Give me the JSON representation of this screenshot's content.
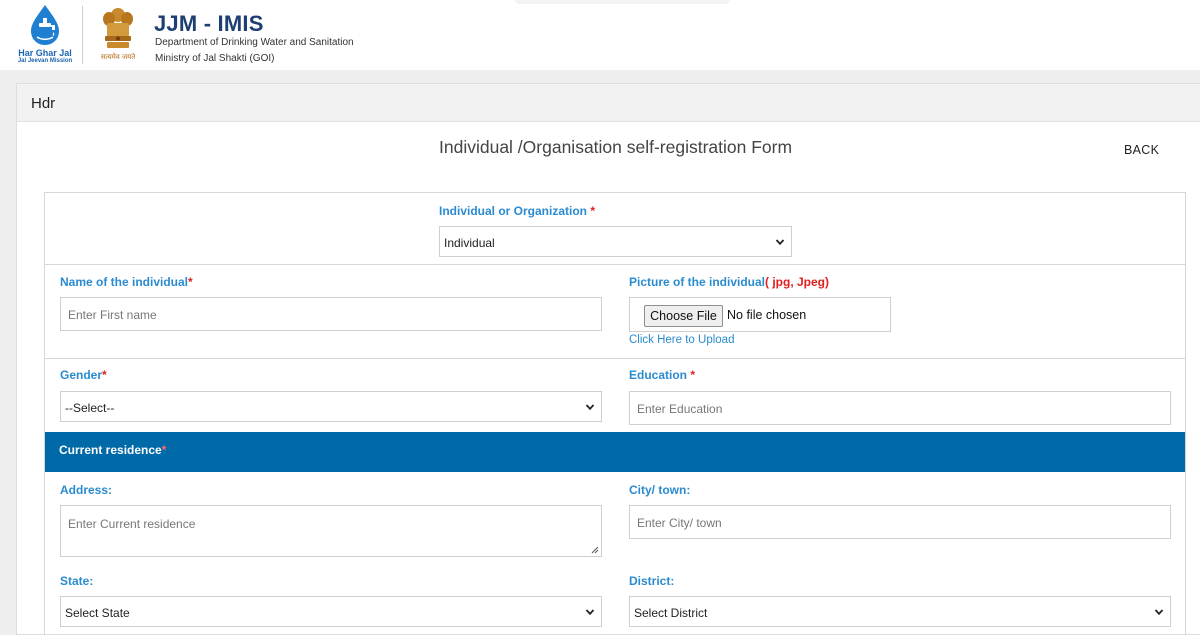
{
  "header": {
    "logo_line1": "Har Ghar Jal",
    "logo_line2": "Jal Jeevan Mission",
    "emblem_motto": "सत्यमेव जयते",
    "title": "JJM - IMIS",
    "subtitle_line1": "Department of Drinking Water and Sanitation",
    "subtitle_line2": "Ministry of Jal Shakti (GOI)"
  },
  "card": {
    "header_title": "Hdr",
    "form_title": "Individual /Organisation self-registration Form",
    "back_label": "BACK"
  },
  "form": {
    "type_label": "Individual or Organization",
    "type_required": "*",
    "type_value": "Individual",
    "name_label": "Name of the individual",
    "name_required": "*",
    "name_placeholder": "Enter First name",
    "picture_label": "Picture of the individual",
    "picture_formats": "( jpg, Jpeg)",
    "file_button": "Choose File",
    "file_status": "No file chosen",
    "upload_link": "Click Here to Upload",
    "gender_label": "Gender",
    "gender_required": "*",
    "gender_value": "--Select--",
    "education_label": "Education",
    "education_required": "*",
    "education_placeholder": "Enter Education",
    "residence_section": "Current residence",
    "residence_required": "*",
    "address_label": "Address:",
    "address_placeholder": "Enter Current residence",
    "city_label": "City/ town:",
    "city_placeholder": "Enter City/ town",
    "state_label": "State:",
    "state_value": "Select State",
    "district_label": "District:",
    "district_value": "Select District"
  },
  "colors": {
    "label_blue": "#2a8bd0",
    "section_bar": "#006aa8",
    "required_red": "#e02020",
    "brand_navy": "#1d3f72"
  },
  "icons": {
    "jjm_logo": "water-drop-tap-icon",
    "emblem": "national-emblem-icon",
    "select_arrow": "chevron-down-icon",
    "textarea_resize": "resize-grip-icon"
  }
}
